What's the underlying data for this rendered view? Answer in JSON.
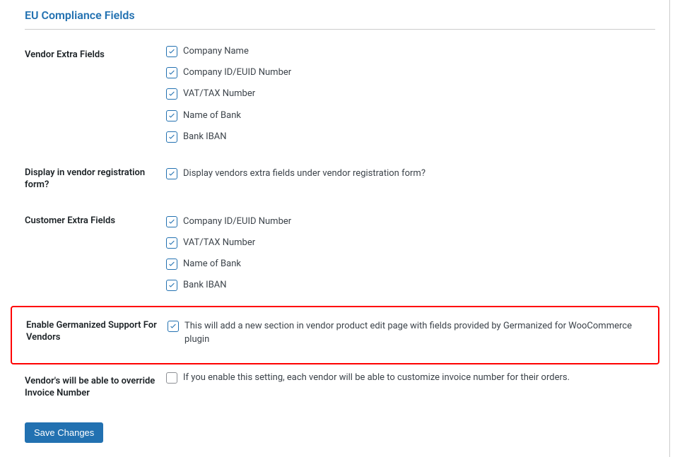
{
  "section_title": "EU Compliance Fields",
  "vendor_extra": {
    "label": "Vendor Extra Fields",
    "items": [
      {
        "label": "Company Name",
        "checked": true
      },
      {
        "label": "Company ID/EUID Number",
        "checked": true
      },
      {
        "label": "VAT/TAX Number",
        "checked": true
      },
      {
        "label": "Name of Bank",
        "checked": true
      },
      {
        "label": "Bank IBAN",
        "checked": true
      }
    ]
  },
  "display_reg": {
    "label": "Display in vendor registration form?",
    "option_label": "Display vendors extra fields under vendor registration form?",
    "checked": true
  },
  "customer_extra": {
    "label": "Customer Extra Fields",
    "items": [
      {
        "label": "Company ID/EUID Number",
        "checked": true
      },
      {
        "label": "VAT/TAX Number",
        "checked": true
      },
      {
        "label": "Name of Bank",
        "checked": true
      },
      {
        "label": "Bank IBAN",
        "checked": true
      }
    ]
  },
  "germanized": {
    "label": "Enable Germanized Support For Vendors",
    "option_label": "This will add a new section in vendor product edit page with fields provided by Germanized for WooCommerce plugin",
    "checked": true
  },
  "override_invoice": {
    "label": "Vendor's will be able to override Invoice Number",
    "option_label": "If you enable this setting, each vendor will be able to customize invoice number for their orders.",
    "checked": false
  },
  "save_button": "Save Changes"
}
